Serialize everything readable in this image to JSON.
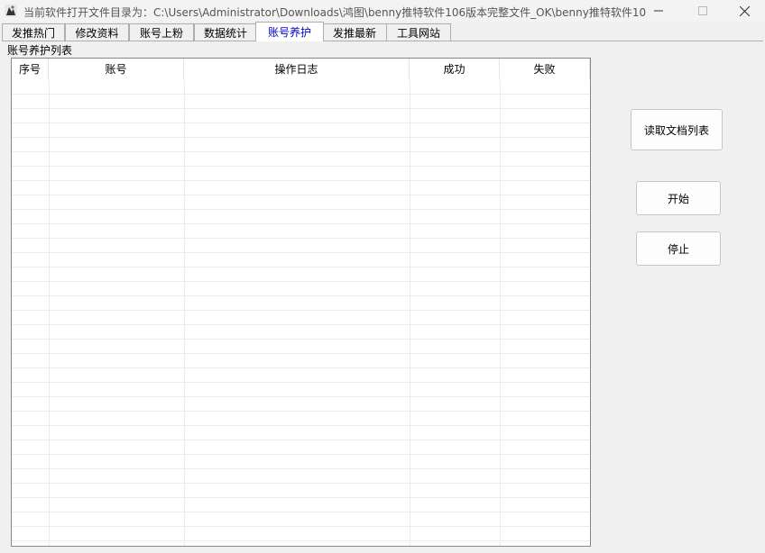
{
  "window": {
    "title": "当前软件打开文件目录为：C:\\Users\\Administrator\\Downloads\\鸿图\\benny推特软件106版本完整文件_OK\\benny推特软件106版...",
    "min_glyph": "—",
    "max_glyph": "☐",
    "close_glyph": "✕"
  },
  "tabs": [
    {
      "label": "发推热门"
    },
    {
      "label": "修改资料"
    },
    {
      "label": "账号上粉"
    },
    {
      "label": "数据统计"
    },
    {
      "label": "账号养护"
    },
    {
      "label": "发推最新"
    },
    {
      "label": "工具网站"
    }
  ],
  "active_tab": "账号养护",
  "group": {
    "label": "账号养护列表"
  },
  "table": {
    "columns": [
      "序号",
      "账号",
      "操作日志",
      "成功",
      "失败"
    ],
    "rows": []
  },
  "buttons": {
    "read_list": "读取文档列表",
    "start": "开始",
    "stop": "停止"
  },
  "colors": {
    "active_tab_text": "#0000cc",
    "background": "#f0f0f0"
  }
}
